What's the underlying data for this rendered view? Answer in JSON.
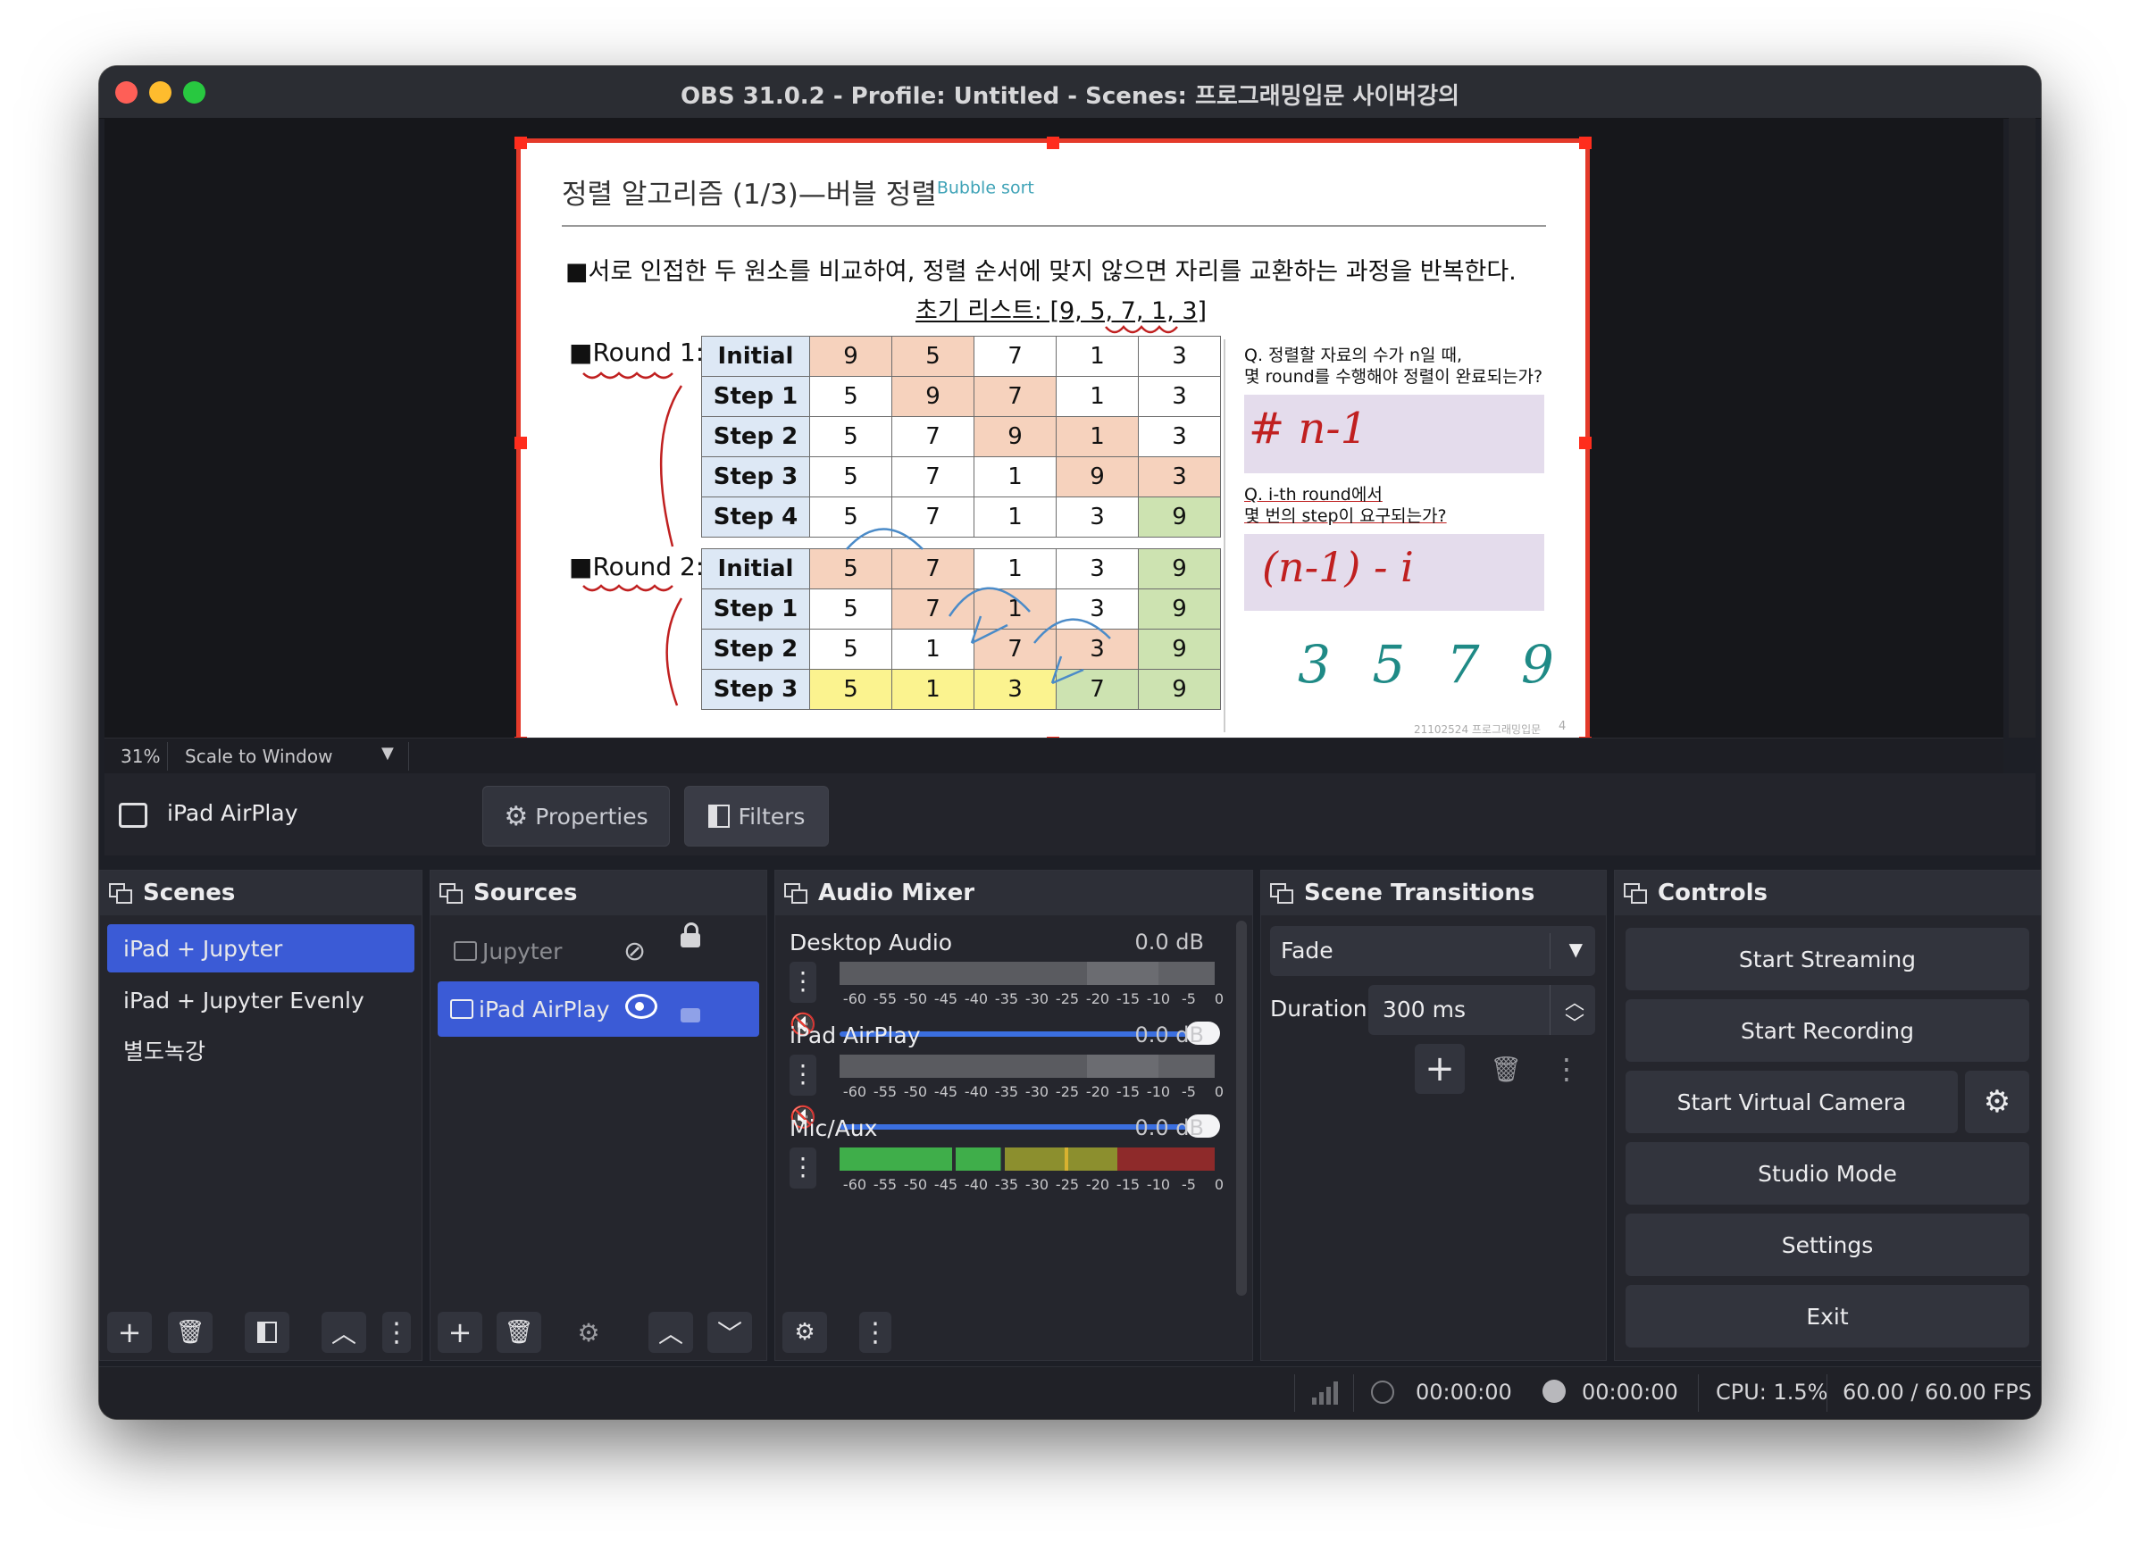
{
  "window": {
    "title": "OBS 31.0.2 - Profile: Untitled - Scenes: 프로그래밍입문 사이버강의"
  },
  "slide": {
    "title": "정렬 알고리즘 (1/3)—버블 정렬",
    "title_sup": "Bubble sort",
    "bullet": "■서로 인접한 두 원소를 비교하여, 정렬 순서에 맞지 않으면 자리를 교환하는 과정을 반복한다.",
    "initial_list": "초기 리스트: [9, 5, 7, 1, 3]",
    "round1_label": "■Round 1:",
    "round2_label": "■Round 2:",
    "round1_rows": [
      {
        "label": "Initial",
        "cells": [
          "9",
          "5",
          "7",
          "1",
          "3"
        ]
      },
      {
        "label": "Step 1",
        "cells": [
          "5",
          "9",
          "7",
          "1",
          "3"
        ]
      },
      {
        "label": "Step 2",
        "cells": [
          "5",
          "7",
          "9",
          "1",
          "3"
        ]
      },
      {
        "label": "Step 3",
        "cells": [
          "5",
          "7",
          "1",
          "9",
          "3"
        ]
      },
      {
        "label": "Step 4",
        "cells": [
          "5",
          "7",
          "1",
          "3",
          "9"
        ]
      }
    ],
    "round2_rows": [
      {
        "label": "Initial",
        "cells": [
          "5",
          "7",
          "1",
          "3",
          "9"
        ]
      },
      {
        "label": "Step 1",
        "cells": [
          "5",
          "7",
          "1",
          "3",
          "9"
        ]
      },
      {
        "label": "Step 2",
        "cells": [
          "5",
          "1",
          "7",
          "3",
          "9"
        ]
      },
      {
        "label": "Step 3",
        "cells": [
          "5",
          "1",
          "3",
          "7",
          "9"
        ]
      }
    ],
    "q1_line1": "Q. 정렬할 자료의 수가 n일 때,",
    "q1_line2": "몇 round를 수행해야 정렬이 완료되는가?",
    "q2_line1": "Q. i-th round에서",
    "q2_line2": "몇 번의 step이 요구되는가?",
    "hw_answer1": "# n-1",
    "hw_answer2": "(n-1) - i",
    "hw_numbers": "3 5 7 9",
    "footer": "21102524 프로그래밍입문",
    "page_no": "4"
  },
  "zoom": {
    "percent": "31%",
    "mode": "Scale to Window"
  },
  "context": {
    "source_name": "iPad AirPlay",
    "properties_label": "Properties",
    "filters_label": "Filters"
  },
  "scenes": {
    "title": "Scenes",
    "items": [
      "iPad + Jupyter",
      "iPad + Jupyter Evenly",
      "별도녹강"
    ],
    "selected": 0
  },
  "sources": {
    "title": "Sources",
    "items": [
      {
        "name": "Jupyter",
        "visible": false,
        "locked": true
      },
      {
        "name": "iPad AirPlay",
        "visible": true,
        "locked": false
      }
    ]
  },
  "mixer": {
    "title": "Audio Mixer",
    "channels": [
      {
        "name": "Desktop Audio",
        "db": "0.0 dB",
        "muted": true,
        "volume": 1.0
      },
      {
        "name": "iPad AirPlay",
        "db": "0.0 dB",
        "muted": true,
        "volume": 1.0
      },
      {
        "name": "Mic/Aux",
        "db": "0.0 dB",
        "muted": false,
        "volume": 1.0
      }
    ],
    "scale": [
      "-60",
      "-55",
      "-50",
      "-45",
      "-40",
      "-35",
      "-30",
      "-25",
      "-20",
      "-15",
      "-10",
      "-5",
      "0"
    ]
  },
  "transitions": {
    "title": "Scene Transitions",
    "selected": "Fade",
    "duration_label": "Duration",
    "duration_value": "300 ms"
  },
  "controls": {
    "title": "Controls",
    "start_streaming": "Start Streaming",
    "start_recording": "Start Recording",
    "start_virtual_camera": "Start Virtual Camera",
    "studio_mode": "Studio Mode",
    "settings": "Settings",
    "exit": "Exit"
  },
  "status": {
    "stream_time": "00:00:00",
    "record_time": "00:00:00",
    "cpu": "CPU: 1.5%",
    "fps": "60.00 / 60.00 FPS"
  },
  "colors": {
    "accent": "#3b5bd6",
    "selection_border": "#e43a2a",
    "mute_red": "#c0392b"
  }
}
